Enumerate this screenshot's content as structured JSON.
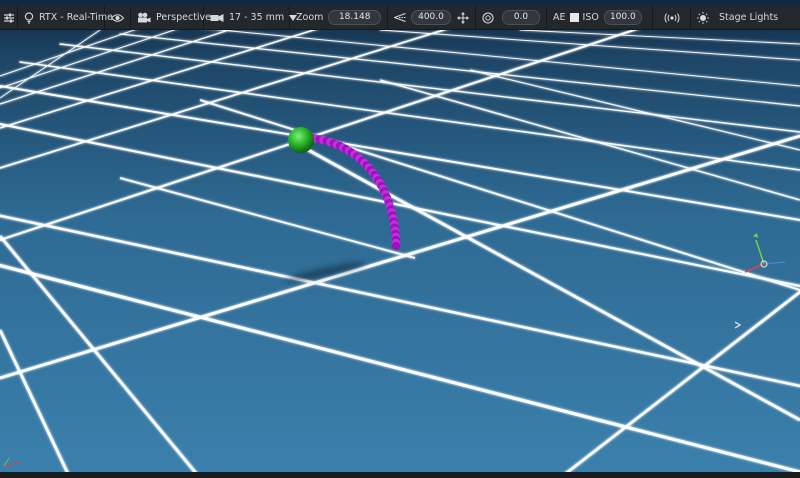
{
  "toolbar": {
    "settings_icon": "sliders-icon",
    "renderer": {
      "icon": "lightbulb-icon",
      "label": "RTX - Real-Time"
    },
    "visibility_icon": "eye-icon",
    "camera": {
      "icon": "movie-camera-icon",
      "label": "Perspective"
    },
    "lens": {
      "icon": "camera-lens-icon",
      "label": "17 - 35 mm"
    },
    "zoom": {
      "label": "Zoom",
      "value": "18.148"
    },
    "clipping": {
      "icon": "angle-icon",
      "value": "400.0"
    },
    "move_icon": "move-arrows-icon",
    "exposure": {
      "icon": "aperture-icon",
      "value": "0.0"
    },
    "ae_label": "AE",
    "iso": {
      "label": "ISO",
      "value": "100.0"
    },
    "audio_icon": "broadcast-icon",
    "stage_lights": {
      "icon": "stage-light-icon",
      "label": "Stage Lights"
    }
  },
  "scene": {
    "floor_color": "#2f6f9a",
    "grid_line_color": "#ffffff",
    "ball_color": "#2db82d",
    "rope_color": "#b01ed0"
  }
}
